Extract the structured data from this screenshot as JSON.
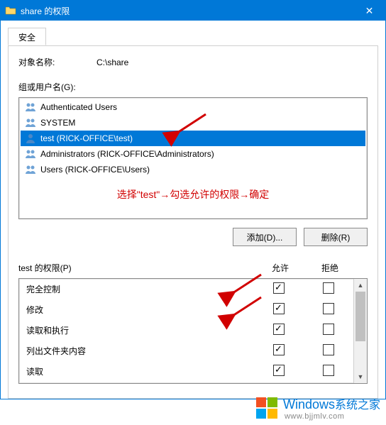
{
  "window": {
    "title": "share 的权限",
    "close_glyph": "✕"
  },
  "tab": {
    "label": "安全"
  },
  "object": {
    "label": "对象名称:",
    "value": "C:\\share"
  },
  "groups": {
    "label": "组或用户名(G):",
    "items": [
      {
        "icon": "group",
        "text": "Authenticated Users"
      },
      {
        "icon": "group",
        "text": "SYSTEM"
      },
      {
        "icon": "user",
        "text": "test (RICK-OFFICE\\test)",
        "selected": true
      },
      {
        "icon": "group",
        "text": "Administrators (RICK-OFFICE\\Administrators)"
      },
      {
        "icon": "group",
        "text": "Users (RICK-OFFICE\\Users)"
      }
    ],
    "note": "选择\"test\"→勾选允许的权限→确定"
  },
  "buttons": {
    "add": "添加(D)...",
    "remove": "删除(R)"
  },
  "perms": {
    "header_label": "test 的权限(P)",
    "col_allow": "允许",
    "col_deny": "拒绝",
    "rows": [
      {
        "name": "完全控制",
        "allow": true,
        "deny": false
      },
      {
        "name": "修改",
        "allow": true,
        "deny": false
      },
      {
        "name": "读取和执行",
        "allow": true,
        "deny": false
      },
      {
        "name": "列出文件夹内容",
        "allow": true,
        "deny": false
      },
      {
        "name": "读取",
        "allow": true,
        "deny": false
      }
    ]
  },
  "watermark": {
    "main": "Windows",
    "sub_a": "系统之家",
    "url": "www.bjjmlv.com"
  }
}
